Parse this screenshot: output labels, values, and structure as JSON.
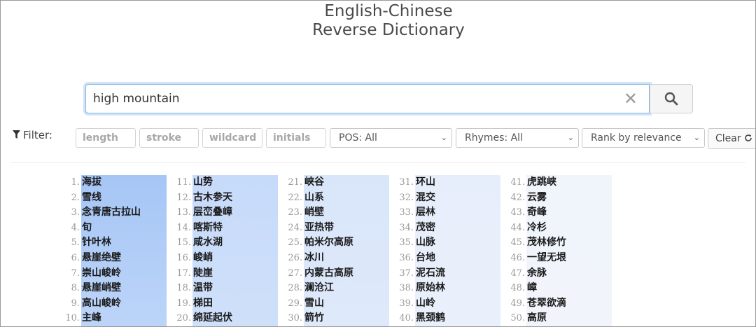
{
  "header": {
    "title_line1": "English-Chinese",
    "title_line2": "Reverse Dictionary"
  },
  "search": {
    "value": "high mountain",
    "clear_icon": "close-icon",
    "button_icon": "search-icon"
  },
  "filter": {
    "label": "Filter:",
    "icon": "funnel-icon",
    "length_placeholder": "length",
    "stroke_placeholder": "stroke",
    "wildcard_placeholder": "wildcard",
    "initials_placeholder": "initials",
    "pos_selected": "POS: All",
    "rhymes_selected": "Rhymes: All",
    "rank_selected": "Rank by relevance",
    "clear_label": "Clear"
  },
  "colors": {
    "accent_blue": "#86b7e8",
    "col1_bg_start": "#a9c8f6",
    "col5_bg": "#eef3fb"
  },
  "results": [
    [
      "海拔",
      "雪线",
      "念青唐古拉山",
      "旬",
      "针叶林",
      "悬崖绝壁",
      "崇山峻岭",
      "悬崖峭壁",
      "高山峻岭",
      "主峰"
    ],
    [
      "山势",
      "古木参天",
      "层峦叠嶂",
      "喀斯特",
      "咸水湖",
      "峻峭",
      "陡崖",
      "温带",
      "梯田",
      "绵延起伏"
    ],
    [
      "峡谷",
      "山系",
      "峭壁",
      "亚热带",
      "帕米尔高原",
      "冰川",
      "内蒙古高原",
      "澜沧江",
      "雪山",
      "箭竹"
    ],
    [
      "环山",
      "混交",
      "层林",
      "茂密",
      "山脉",
      "台地",
      "泥石流",
      "原始林",
      "山岭",
      "黑颈鹤"
    ],
    [
      "虎跳峡",
      "云雾",
      "奇峰",
      "冷杉",
      "茂林修竹",
      "一望无垠",
      "余脉",
      "嶂",
      "苍翠欲滴",
      "高原"
    ]
  ]
}
